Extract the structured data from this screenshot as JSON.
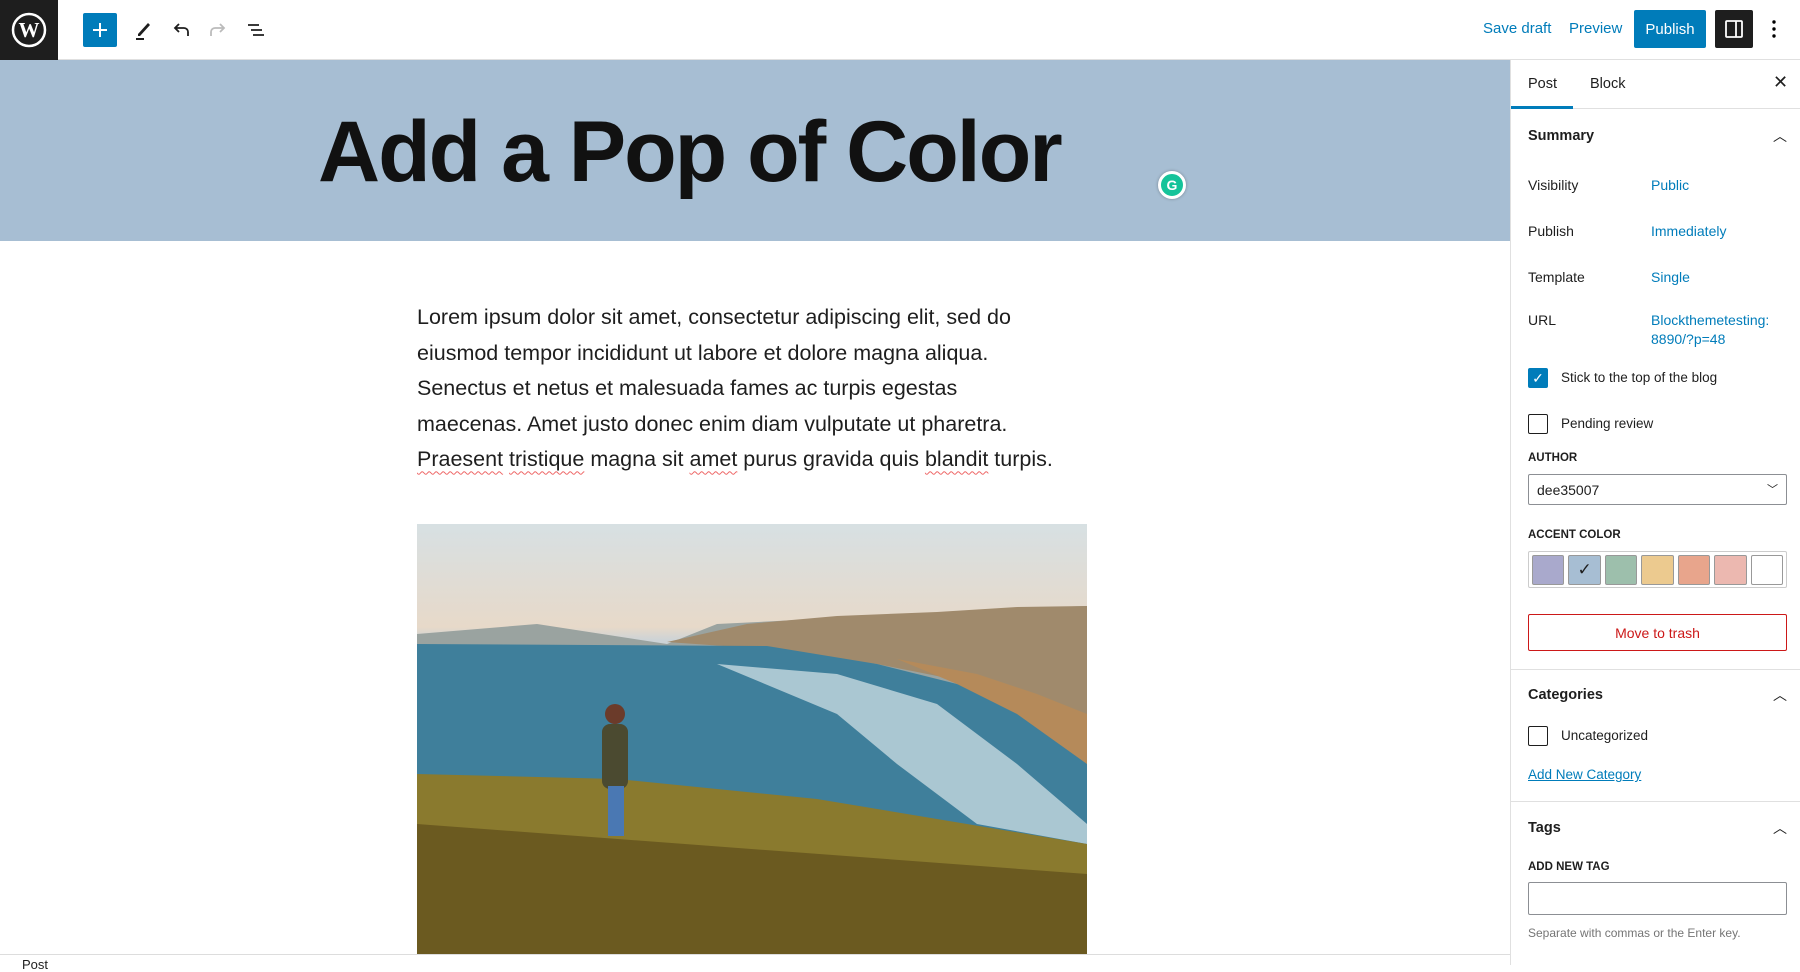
{
  "toolbar": {
    "save_draft": "Save draft",
    "preview": "Preview",
    "publish": "Publish"
  },
  "post": {
    "title": "Add a Pop of Color",
    "header_color": "#a7bed3",
    "paragraph": [
      "Lorem ipsum dolor sit amet, consectetur adipiscing elit, sed do",
      "eiusmod tempor incididunt ut labore et dolore magna aliqua.",
      "Senectus et netus et malesuada fames ac turpis egestas",
      "maecenas. Amet justo donec enim diam vulputate ut pharetra."
    ],
    "last_line": {
      "w1": "Praesent",
      "s1": " ",
      "w2": "tristique",
      "s2": " magna sit ",
      "w3": "amet",
      "s3": " purus gravida quis ",
      "w4": "blandit",
      "s4": " turpis."
    }
  },
  "footer": {
    "breadcrumb": "Post"
  },
  "sidebar": {
    "tabs": [
      "Post",
      "Block"
    ],
    "summary": {
      "title": "Summary",
      "visibility_label": "Visibility",
      "visibility": "Public",
      "publish_label": "Publish",
      "publish": "Immediately",
      "template_label": "Template",
      "template": "Single",
      "url_label": "URL",
      "url": [
        "Blockthemetesting:",
        "8890/?p=48"
      ],
      "sticky": "Stick to the top of the blog",
      "sticky_checked": true,
      "pending": "Pending review",
      "pending_checked": false,
      "author_label": "AUTHOR",
      "author": "dee35007",
      "accent_label": "ACCENT COLOR",
      "accent_colors": [
        "#a9a9cc",
        "#a7bed3",
        "#9dbfac",
        "#ecca8f",
        "#e8a58c",
        "#ecb8b0",
        "#ffffff"
      ],
      "accent_selected": 1,
      "trash": "Move to trash"
    },
    "categories": {
      "title": "Categories",
      "items": [
        {
          "label": "Uncategorized",
          "checked": false
        }
      ],
      "add": "Add New Category"
    },
    "tags": {
      "title": "Tags",
      "label": "ADD NEW TAG",
      "value": "",
      "help": "Separate with commas or the Enter key."
    }
  }
}
